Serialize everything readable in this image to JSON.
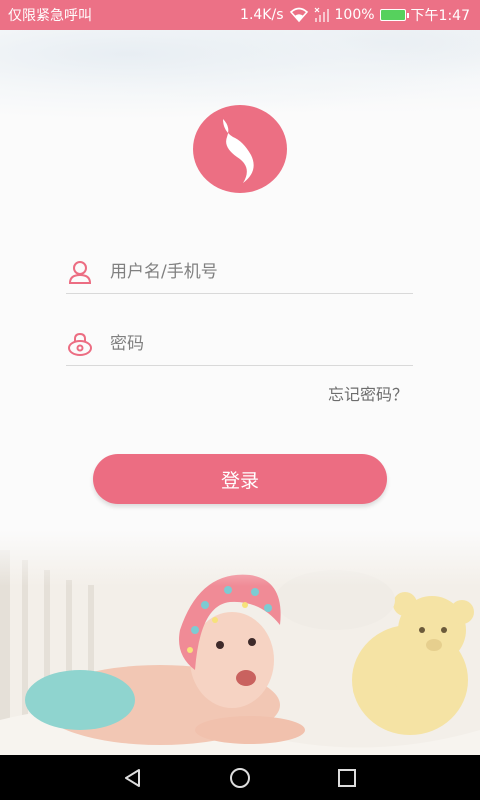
{
  "status_bar": {
    "carrier": "仅限紧急呼叫",
    "speed": "1.4K/s",
    "battery_percent": "100%",
    "time": "下午1:47",
    "icons": [
      "wifi-icon",
      "signal-icon",
      "battery-icon"
    ]
  },
  "logo": {
    "icon": "logo-icon",
    "color": "#ec6f83"
  },
  "form": {
    "username": {
      "placeholder": "用户名/手机号",
      "value": "",
      "icon": "user-icon"
    },
    "password": {
      "placeholder": "密码",
      "value": "",
      "icon": "lock-icon"
    },
    "forgot_label": "忘记密码？",
    "login_label": "登录"
  },
  "colors": {
    "accent": "#ec6d82",
    "status_bar": "#ec7186"
  },
  "nav_bar": {
    "buttons": [
      "back-icon",
      "home-icon",
      "recents-icon"
    ]
  }
}
